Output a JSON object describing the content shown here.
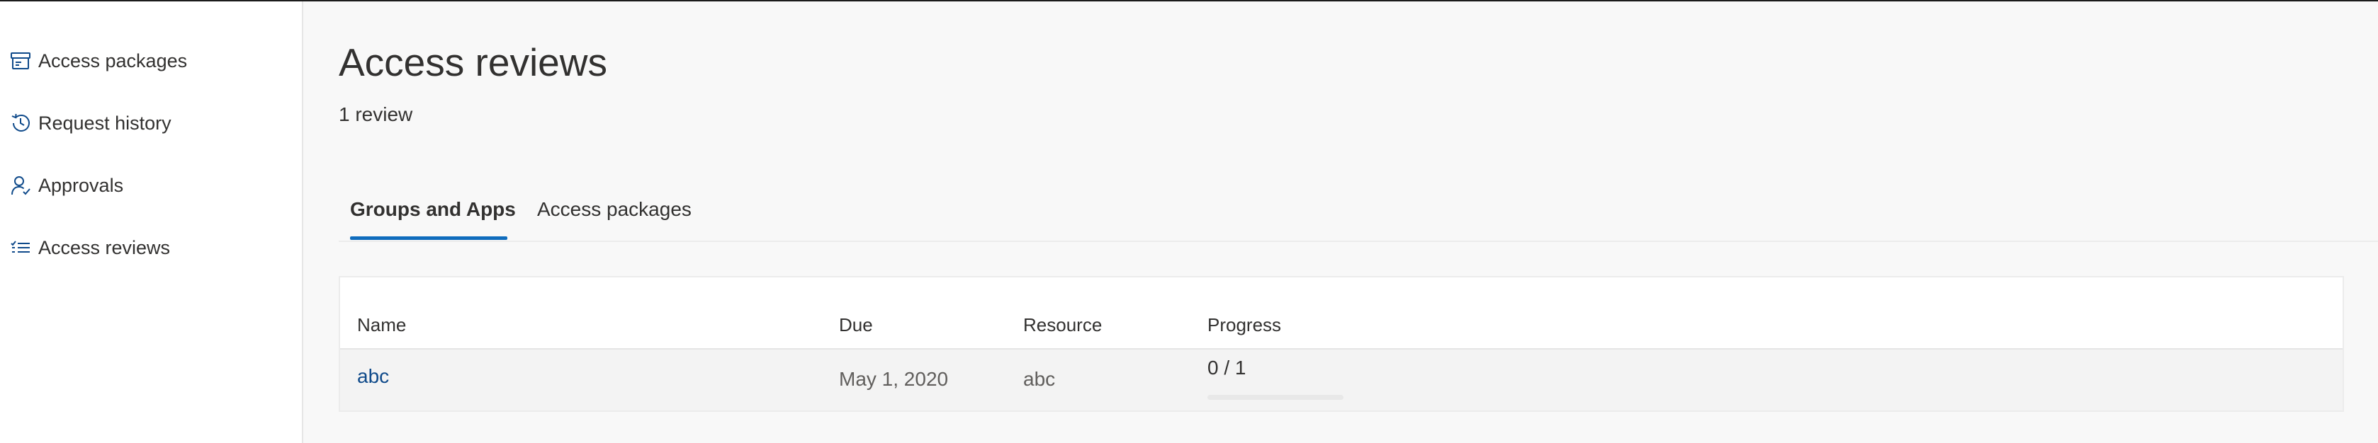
{
  "sidebar": {
    "items": [
      {
        "label": "Access packages",
        "icon": "archive-box-icon"
      },
      {
        "label": "Request history",
        "icon": "history-icon"
      },
      {
        "label": "Approvals",
        "icon": "person-approve-icon"
      },
      {
        "label": "Access reviews",
        "icon": "checklist-icon"
      }
    ]
  },
  "page": {
    "title": "Access reviews",
    "subtitle": "1 review"
  },
  "tabs": [
    {
      "label": "Groups and Apps",
      "selected": true
    },
    {
      "label": "Access packages",
      "selected": false
    }
  ],
  "table": {
    "columns": [
      "Name",
      "Due",
      "Resource",
      "Progress"
    ],
    "rows": [
      {
        "name": "abc",
        "due": "May 1, 2020",
        "resource": "abc",
        "progress_text": "0 / 1",
        "progress_fraction": 0
      }
    ]
  },
  "colors": {
    "accent": "#0f6cbd",
    "link": "#0f4a8a",
    "text": "#323130",
    "muted_text": "#605e5c",
    "page_background": "#f8f8f8",
    "sidebar_background": "#ffffff"
  }
}
